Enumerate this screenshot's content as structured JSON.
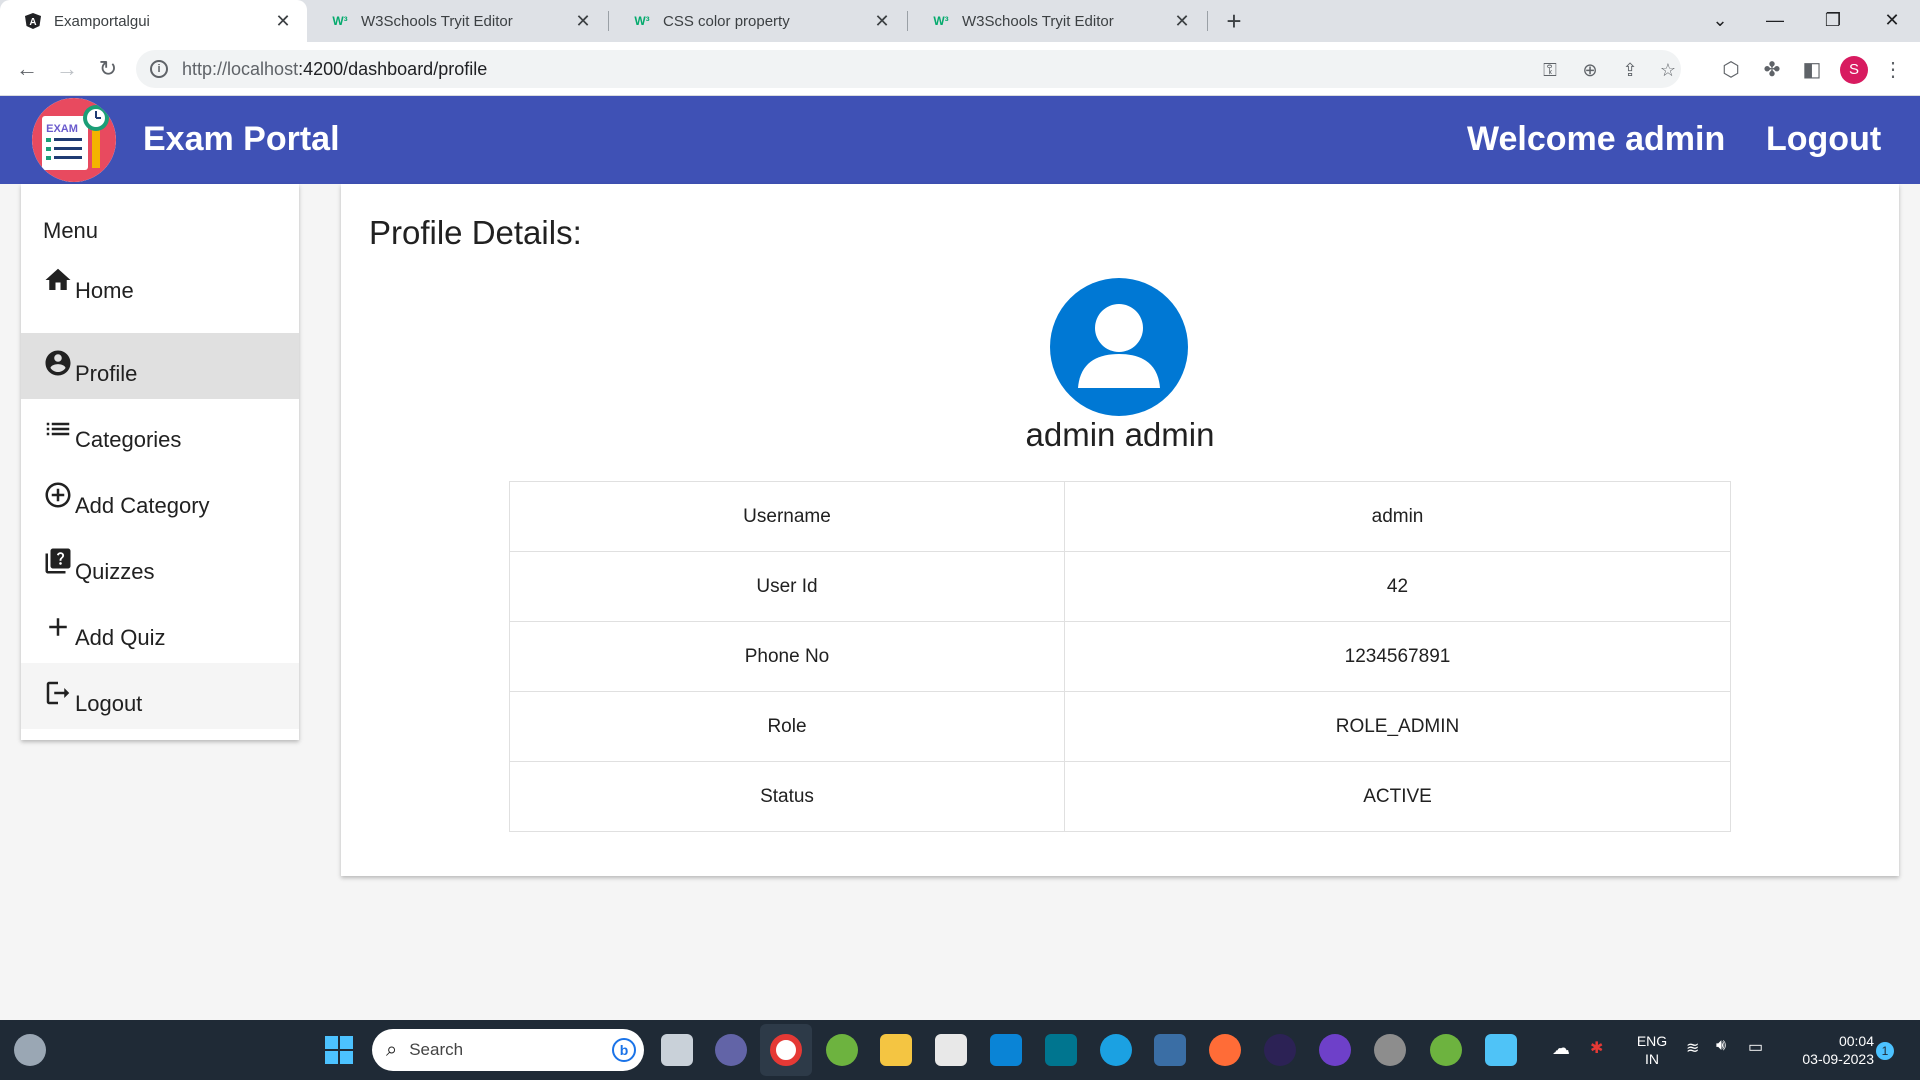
{
  "browser": {
    "tabs": [
      {
        "title": "Examportalgui",
        "active": true
      },
      {
        "title": "W3Schools Tryit Editor",
        "active": false
      },
      {
        "title": "CSS color property",
        "active": false
      },
      {
        "title": "W3Schools Tryit Editor",
        "active": false
      }
    ],
    "url_host": "http://localhost",
    "url_path": ":4200/dashboard/profile",
    "profile_initial": "S"
  },
  "header": {
    "title": "Exam Portal",
    "welcome": "Welcome admin",
    "logout": "Logout",
    "logo_text": "EXAM",
    "color": "#3f51b5"
  },
  "sidebar": {
    "heading": "Menu",
    "items": [
      {
        "label": "Home",
        "icon": "home-icon"
      },
      {
        "label": "Profile",
        "icon": "account-circle-icon"
      },
      {
        "label": "Categories",
        "icon": "list-icon"
      },
      {
        "label": "Add Category",
        "icon": "add-circle-icon"
      },
      {
        "label": "Quizzes",
        "icon": "quiz-icon"
      },
      {
        "label": "Add Quiz",
        "icon": "add-icon"
      },
      {
        "label": "Logout",
        "icon": "logout-icon"
      }
    ]
  },
  "profile": {
    "title": "Profile Details:",
    "name": "admin admin",
    "rows": [
      {
        "label": "Username",
        "value": "admin"
      },
      {
        "label": "User Id",
        "value": "42"
      },
      {
        "label": "Phone No",
        "value": "1234567891"
      },
      {
        "label": "Role",
        "value": "ROLE_ADMIN"
      },
      {
        "label": "Status",
        "value": "ACTIVE"
      }
    ]
  },
  "taskbar": {
    "search_placeholder": "Search",
    "lang_line1": "ENG",
    "lang_line2": "IN",
    "time": "00:04",
    "date": "03-09-2023",
    "notifications": "1"
  }
}
